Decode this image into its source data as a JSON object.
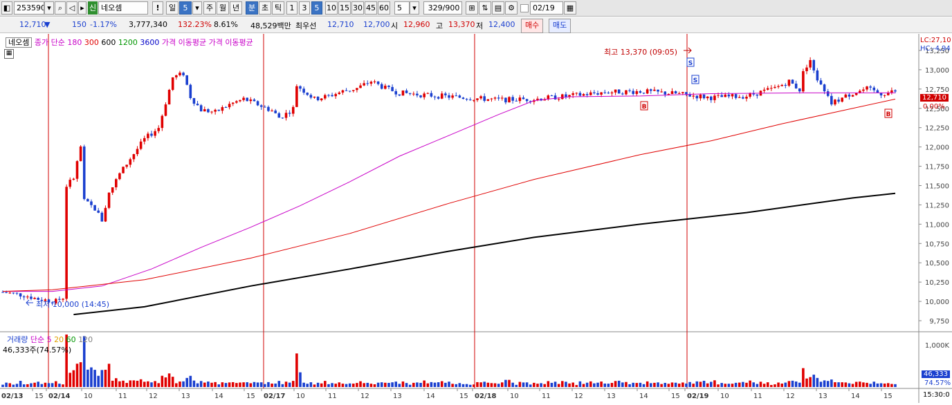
{
  "toolbar": {
    "code": "253590",
    "badge": "신",
    "name": "네오셈",
    "exclaim": "!",
    "period_label": "일",
    "period_value": "5",
    "periods": [
      "주",
      "월",
      "년"
    ],
    "active_unit": "분",
    "units": [
      "초",
      "틱"
    ],
    "minutes": [
      "1",
      "3",
      "5",
      "10",
      "15",
      "30",
      "45",
      "60"
    ],
    "active_minute": "5",
    "interval_value": "5",
    "count": "329/900",
    "date": "02/19"
  },
  "quote": {
    "price": "12,710",
    "arrow": "▼",
    "change": "150",
    "change_pct": "-1.17%",
    "volume": "3,777,340",
    "vol_ratio": "132.23%",
    "turnover": "8.61%",
    "amount": "48,529백만",
    "best_label": "최우선",
    "best_ask": "12,710",
    "best_bid": "12,700",
    "open_label": "시",
    "open": "12,960",
    "high_label": "고",
    "high": "13,370",
    "low_label": "저",
    "low": "12,400",
    "buy_label": "매수",
    "sell_label": "매도"
  },
  "price_legend": {
    "name": "네오셈",
    "ma_title": "종가 단순",
    "ma_periods": [
      {
        "label": "180",
        "color": "#c800c8"
      },
      {
        "label": "300",
        "color": "#e00000"
      },
      {
        "label": "600",
        "color": "#000000"
      },
      {
        "label": "1200",
        "color": "#009600"
      },
      {
        "label": "3600",
        "color": "#0000c8"
      }
    ],
    "extra1": "가격 이동평균",
    "extra2": "가격 이동평균"
  },
  "volume_legend": {
    "title": "거래량",
    "ma_title": "단순",
    "ma_periods": [
      {
        "label": "5",
        "color": "#c800c8"
      },
      {
        "label": "20",
        "color": "#e0a000"
      },
      {
        "label": "60",
        "color": "#009600"
      },
      {
        "label": "120",
        "color": "#808080"
      }
    ],
    "current": "46,333주(74.57%)"
  },
  "annotations": {
    "high": "최고 13,370 (09:05)",
    "low": "최저 10,000 (14:45)",
    "signal_s": "S",
    "signal_b": "B"
  },
  "right_labels": {
    "lc": "LC:27,10",
    "hc": "HC:-4,94",
    "price_tag": "12,710",
    "pct_tag": "0.00%",
    "vol_tag": "46,333",
    "vol_pct": "74.57%",
    "time": "15:30:0"
  },
  "chart_data": {
    "type": "candlestick",
    "price_axis": {
      "min": 9625,
      "max": 13375,
      "ticks": [
        "13,250",
        "13,000",
        "12,750",
        "12,500",
        "12,250",
        "12,000",
        "11,750",
        "11,500",
        "11,250",
        "11,000",
        "10,750",
        "10,500",
        "10,250",
        "10,000",
        "9,750"
      ]
    },
    "volume_axis": {
      "max": 1300000,
      "ticks": [
        "1,000K"
      ]
    },
    "x_labels": [
      {
        "t": "02/13",
        "day": true
      },
      {
        "t": "15"
      },
      {
        "t": "02/14",
        "day": true
      },
      {
        "t": "10"
      },
      {
        "t": "11"
      },
      {
        "t": "12"
      },
      {
        "t": "13"
      },
      {
        "t": "14"
      },
      {
        "t": "15"
      },
      {
        "t": "02/17",
        "day": true
      },
      {
        "t": "10"
      },
      {
        "t": "11"
      },
      {
        "t": "12"
      },
      {
        "t": "13"
      },
      {
        "t": "14"
      },
      {
        "t": "15"
      },
      {
        "t": "02/18",
        "day": true
      },
      {
        "t": "10"
      },
      {
        "t": "11"
      },
      {
        "t": "12"
      },
      {
        "t": "13"
      },
      {
        "t": "14"
      },
      {
        "t": "15"
      },
      {
        "t": "02/19",
        "day": true
      },
      {
        "t": "10"
      },
      {
        "t": "11"
      },
      {
        "t": "12"
      },
      {
        "t": "13"
      },
      {
        "t": "14"
      },
      {
        "t": "15"
      }
    ],
    "ma_180": [
      [
        0,
        10130
      ],
      [
        14,
        10130
      ],
      [
        28,
        10200
      ],
      [
        42,
        10420
      ],
      [
        56,
        10700
      ],
      [
        70,
        10960
      ],
      [
        84,
        11240
      ],
      [
        98,
        11550
      ],
      [
        112,
        11880
      ],
      [
        126,
        12150
      ],
      [
        140,
        12420
      ],
      [
        150,
        12600
      ],
      [
        160,
        12650
      ],
      [
        180,
        12660
      ],
      [
        200,
        12690
      ],
      [
        225,
        12700
      ],
      [
        252,
        12700
      ]
    ],
    "ma_300": [
      [
        0,
        10130
      ],
      [
        14,
        10150
      ],
      [
        40,
        10280
      ],
      [
        70,
        10560
      ],
      [
        98,
        10880
      ],
      [
        126,
        11270
      ],
      [
        150,
        11580
      ],
      [
        180,
        11900
      ],
      [
        200,
        12080
      ],
      [
        220,
        12300
      ],
      [
        238,
        12480
      ],
      [
        252,
        12620
      ]
    ],
    "ma_600": [
      [
        20,
        9830
      ],
      [
        40,
        9930
      ],
      [
        70,
        10200
      ],
      [
        98,
        10420
      ],
      [
        126,
        10650
      ],
      [
        150,
        10830
      ],
      [
        180,
        11000
      ],
      [
        210,
        11150
      ],
      [
        240,
        11340
      ],
      [
        252,
        11400
      ]
    ]
  }
}
